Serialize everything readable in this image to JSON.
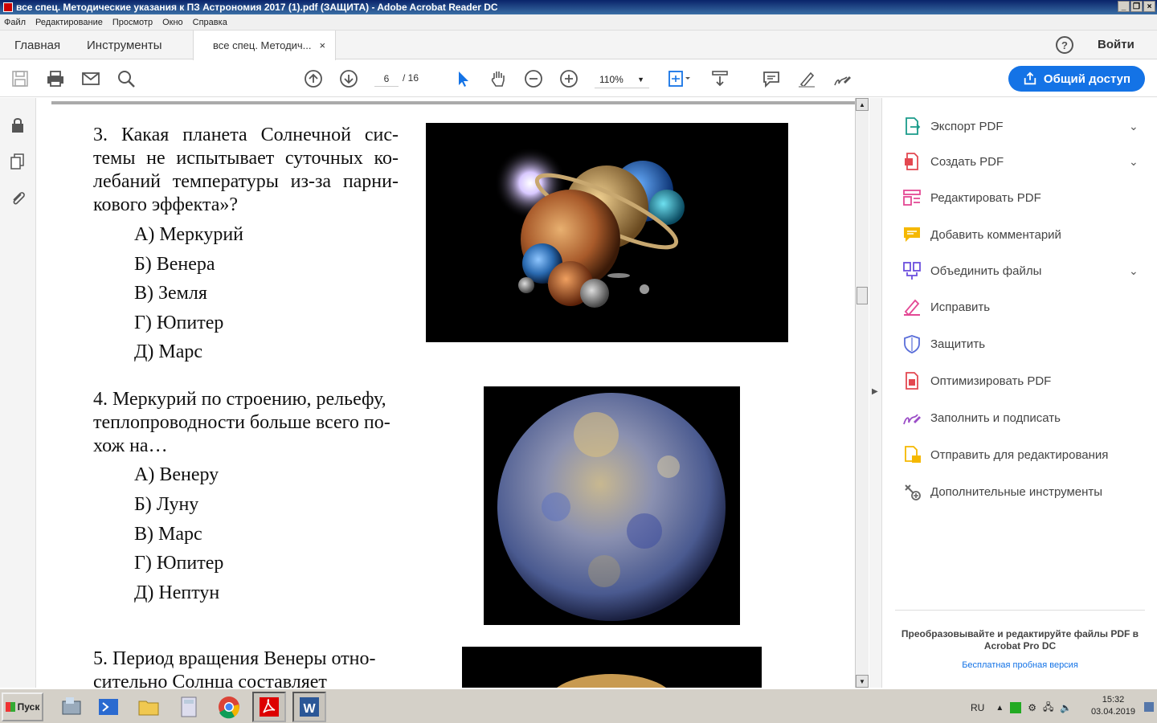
{
  "window": {
    "title": "все спец. Методические указания к ПЗ Астрономия 2017 (1).pdf (ЗАЩИТА) - Adobe Acrobat Reader DC"
  },
  "menu": [
    "Файл",
    "Редактирование",
    "Просмотр",
    "Окно",
    "Справка"
  ],
  "tabs": {
    "home": "Главная",
    "tools": "Инструменты",
    "doc": "все спец. Методич...",
    "close": "×"
  },
  "header": {
    "help": "?",
    "signin": "Войти"
  },
  "toolbar": {
    "page_current": "6",
    "page_total": "/ 16",
    "zoom": "110%",
    "share": "Общий доступ"
  },
  "document": {
    "q3": {
      "lines": [
        "3. Какая планета Солнечной сис-",
        "темы не испытывает суточных ко-",
        "лебаний температуры из-за парни-",
        "кового эффекта»?"
      ],
      "options": [
        "А) Меркурий",
        "Б) Венера",
        "В) Земля",
        "Г) Юпитер",
        "Д) Марс"
      ]
    },
    "q4": {
      "lines": [
        "4. Меркурий по строению, рельефу,",
        "теплопроводности больше всего по-",
        "хож на…"
      ],
      "options": [
        "А) Венеру",
        "Б) Луну",
        "В) Марс",
        "Г) Юпитер",
        "Д) Нептун"
      ]
    },
    "q5": {
      "lines": [
        "5. Период вращения Венеры отно-",
        "сительно Солнца составляет"
      ]
    }
  },
  "tools": [
    {
      "label": "Экспорт PDF",
      "icon": "export-pdf-icon",
      "color": "#1a9b8a"
    },
    {
      "label": "Создать PDF",
      "icon": "create-pdf-icon",
      "color": "#e34850"
    },
    {
      "label": "Редактировать PDF",
      "icon": "edit-pdf-icon",
      "color": "#e34894"
    },
    {
      "label": "Добавить комментарий",
      "icon": "comment-icon",
      "color": "#f5b800"
    },
    {
      "label": "Объединить файлы",
      "icon": "combine-icon",
      "color": "#6b4ede"
    },
    {
      "label": "Исправить",
      "icon": "fix-icon",
      "color": "#e34894"
    },
    {
      "label": "Защитить",
      "icon": "protect-icon",
      "color": "#5a6ed9"
    },
    {
      "label": "Оптимизировать PDF",
      "icon": "optimize-icon",
      "color": "#e34850"
    },
    {
      "label": "Заполнить и подписать",
      "icon": "fill-sign-icon",
      "color": "#9b4dc7"
    },
    {
      "label": "Отправить для редактирования",
      "icon": "send-review-icon",
      "color": "#f5b800"
    },
    {
      "label": "Дополнительные инструменты",
      "icon": "more-tools-icon",
      "color": "#666666"
    }
  ],
  "promo": {
    "text": "Преобразовывайте и редактируйте файлы PDF в Acrobat Pro DC",
    "link": "Бесплатная пробная версия"
  },
  "taskbar": {
    "start": "Пуск",
    "lang": "RU",
    "time": "15:32",
    "date": "03.04.2019"
  },
  "colors": {
    "accent": "#1473e6"
  }
}
